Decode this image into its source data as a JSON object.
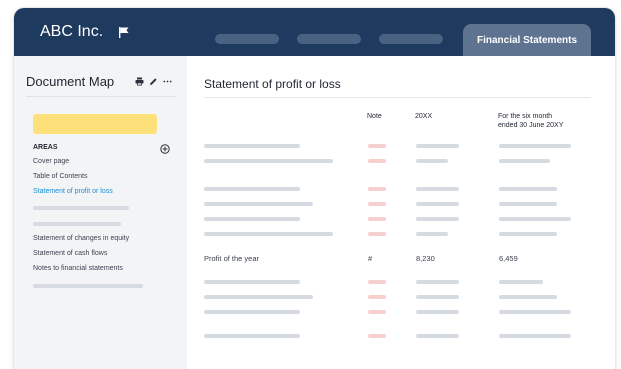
{
  "header": {
    "company_name": "ABC Inc.",
    "flag_icon": "flag-icon",
    "nav_tabs": [
      {
        "label": ""
      },
      {
        "label": ""
      },
      {
        "label": ""
      }
    ],
    "active_tab_label": "Financial Statements",
    "colors": {
      "header_bg": "#1e3a5f",
      "active_tab_bg": "#5d7390"
    }
  },
  "sidebar": {
    "title": "Document Map",
    "icons": [
      "print-icon",
      "edit-icon",
      "more-icon"
    ],
    "section_label": "AREAS",
    "items": [
      {
        "label": "Cover page",
        "active": false
      },
      {
        "label": "Table of Contents",
        "active": false
      },
      {
        "label": "Statement of profit or loss",
        "active": true
      },
      {
        "label": "",
        "active": false
      },
      {
        "label": "",
        "active": false
      },
      {
        "label": "Statement of changes in equity",
        "active": false
      },
      {
        "label": "Statement of cash flows",
        "active": false
      },
      {
        "label": "Notes to financial statements",
        "active": false
      },
      {
        "label": "",
        "active": false
      }
    ],
    "colors": {
      "highlight": "#fde07a",
      "active_link": "#1a8fd6"
    }
  },
  "main": {
    "title": "Statement of profit or loss",
    "columns": {
      "note": "Note",
      "current": "20XX",
      "prior_line1": "For the six month",
      "prior_line2": "ended 30 June 20XY"
    },
    "highlighted_row": {
      "label": "Profit of the year",
      "note": "#",
      "current": "8,230",
      "prior": "6,459"
    }
  }
}
